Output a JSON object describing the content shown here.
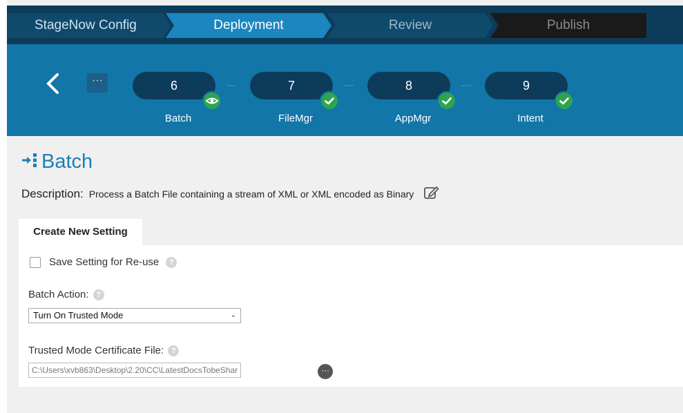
{
  "wizard_tabs": [
    {
      "label": "StageNow Config"
    },
    {
      "label": "Deployment"
    },
    {
      "label": "Review"
    },
    {
      "label": "Publish"
    }
  ],
  "more_label": "···",
  "steps": [
    {
      "number": "6",
      "label": "Batch",
      "status": "viewing"
    },
    {
      "number": "7",
      "label": "FileMgr",
      "status": "done"
    },
    {
      "number": "8",
      "label": "AppMgr",
      "status": "done"
    },
    {
      "number": "9",
      "label": "Intent",
      "status": "done"
    }
  ],
  "page": {
    "title": "Batch",
    "description_label": "Description:",
    "description": "Process a Batch File containing a stream of XML or XML encoded as Binary"
  },
  "tab": {
    "label": "Create New Setting"
  },
  "form": {
    "save_setting_label": "Save Setting for Re-use",
    "batch_action_label": "Batch Action:",
    "batch_action_value": "Turn On Trusted Mode",
    "cert_label": "Trusted Mode Certificate File:",
    "cert_value": "C:\\Users\\xvb863\\Desktop\\2.20\\CC\\LatestDocsTobeShar",
    "help_glyph": "?",
    "browse_glyph": "···",
    "select_chevron": "⌄"
  },
  "colors": {
    "top_bar": "#0d3c5a",
    "progress_bar": "#1276a8",
    "accent_title": "#1b7fb8",
    "check_green": "#2ea44f"
  }
}
